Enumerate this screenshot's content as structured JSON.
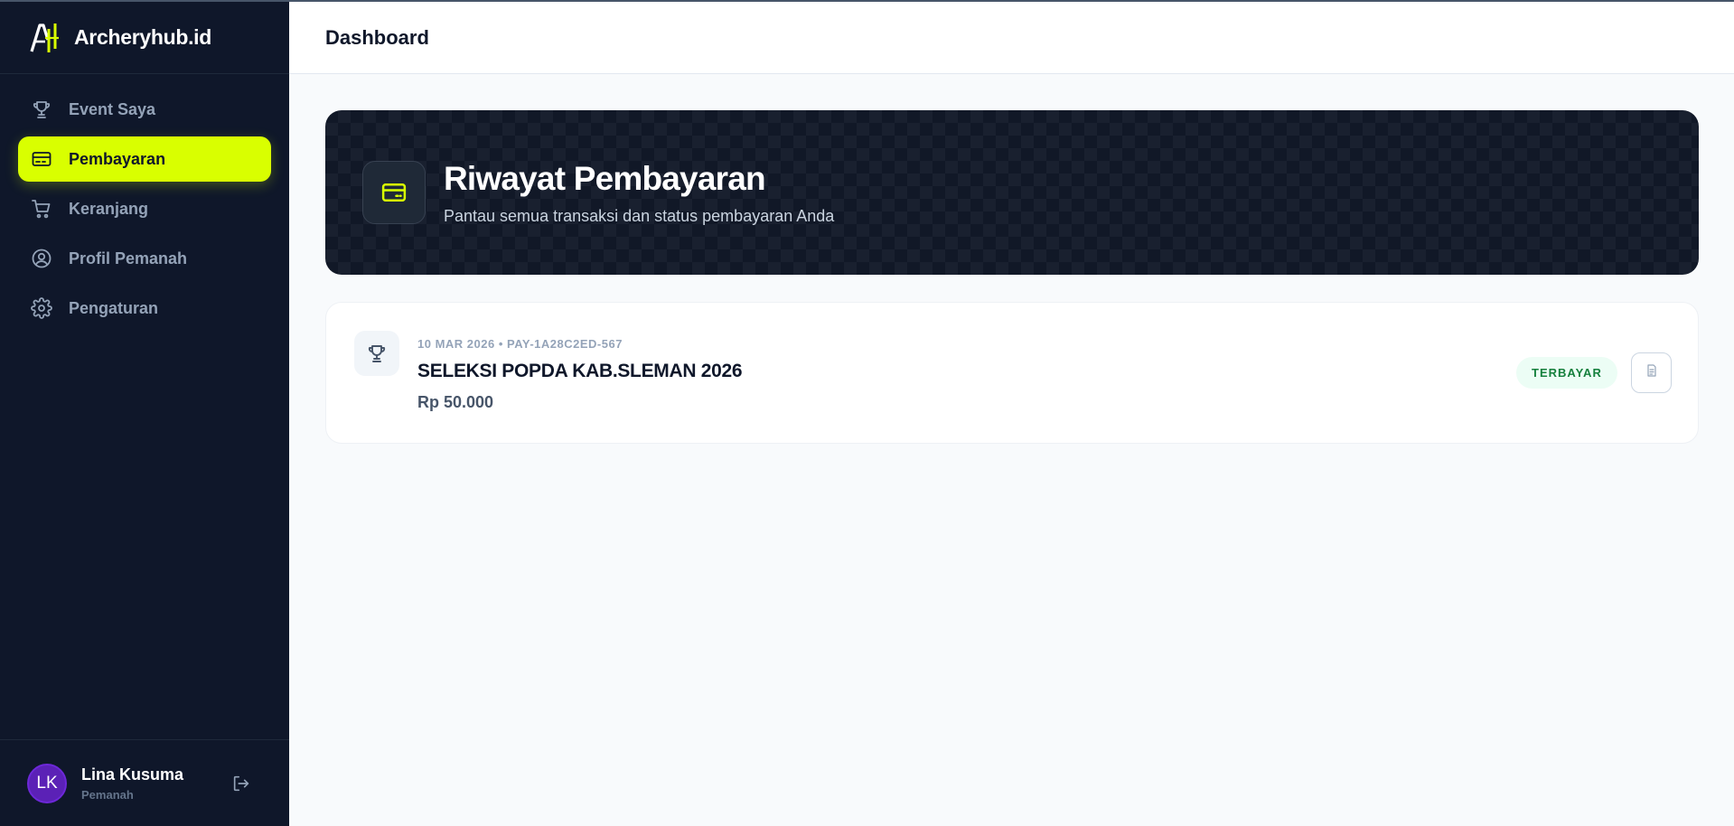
{
  "brand": {
    "name": "Archeryhub.id",
    "logo_icon": "archery-logo-icon"
  },
  "sidebar": {
    "items": [
      {
        "label": "Event Saya",
        "icon": "trophy-icon",
        "active": false
      },
      {
        "label": "Pembayaran",
        "icon": "credit-card-icon",
        "active": true
      },
      {
        "label": "Keranjang",
        "icon": "cart-icon",
        "active": false
      },
      {
        "label": "Profil Pemanah",
        "icon": "user-circle-icon",
        "active": false
      },
      {
        "label": "Pengaturan",
        "icon": "gear-icon",
        "active": false
      }
    ]
  },
  "user": {
    "initials": "LK",
    "name": "Lina Kusuma",
    "role": "Pemanah",
    "logout_icon": "logout-icon"
  },
  "header": {
    "title": "Dashboard"
  },
  "hero": {
    "title": "Riwayat Pembayaran",
    "subtitle": "Pantau semua transaksi dan status pembayaran Anda",
    "icon": "credit-card-icon"
  },
  "payments": [
    {
      "meta": "10 MAR 2026 • PAY-1A28C2ED-567",
      "title": "SELEKSI POPDA KAB.SLEMAN 2026",
      "amount": "Rp 50.000",
      "status": "TERBAYAR",
      "icon": "trophy-icon",
      "action_icon": "receipt-icon"
    }
  ],
  "colors": {
    "sidebar_bg": "#0f172a",
    "accent": "#d9ff00",
    "status_paid_bg": "#ecfdf5",
    "status_paid_text": "#15803d",
    "avatar_bg": "#5b21b6"
  }
}
